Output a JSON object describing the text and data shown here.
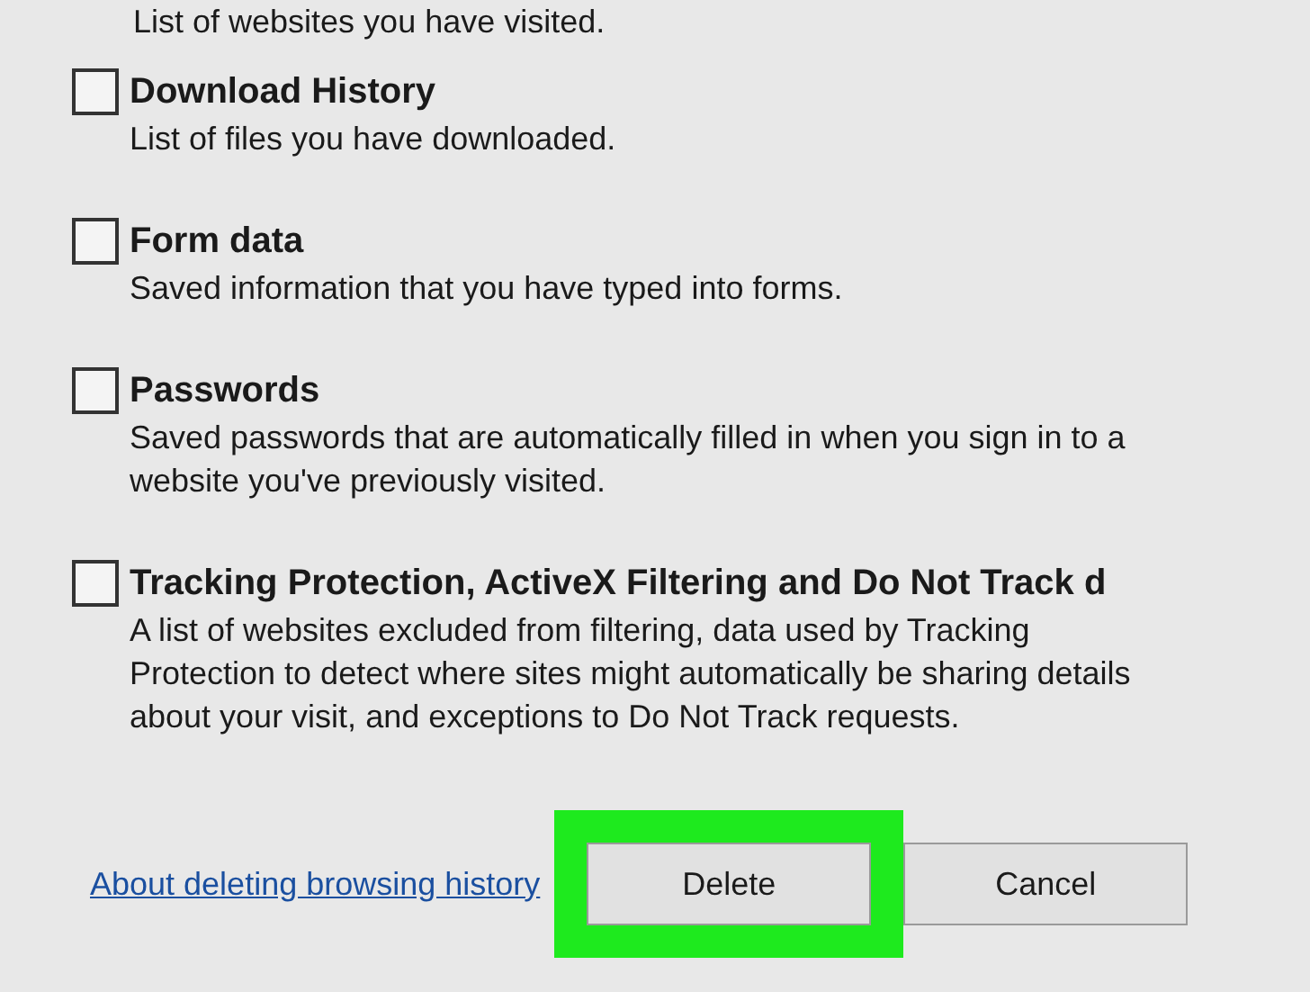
{
  "top_description": "List of websites you have visited.",
  "options": [
    {
      "title": "Download History",
      "description": "List of files you have downloaded.",
      "checked": false
    },
    {
      "title": "Form data",
      "description": "Saved information that you have typed into forms.",
      "checked": false
    },
    {
      "title": "Passwords",
      "description": "Saved passwords that are automatically filled in when you sign in to a website you've previously visited.",
      "checked": false
    },
    {
      "title": "Tracking Protection, ActiveX Filtering and Do Not Track d",
      "description": "A list of websites excluded from filtering, data used by Tracking Protection to detect where sites might automatically be sharing details about your visit, and exceptions to Do Not Track requests.",
      "checked": false
    }
  ],
  "link": "About deleting browsing history",
  "buttons": [
    {
      "label": "Delete",
      "highlighted": true
    },
    {
      "label": "Cancel",
      "highlighted": false
    }
  ]
}
